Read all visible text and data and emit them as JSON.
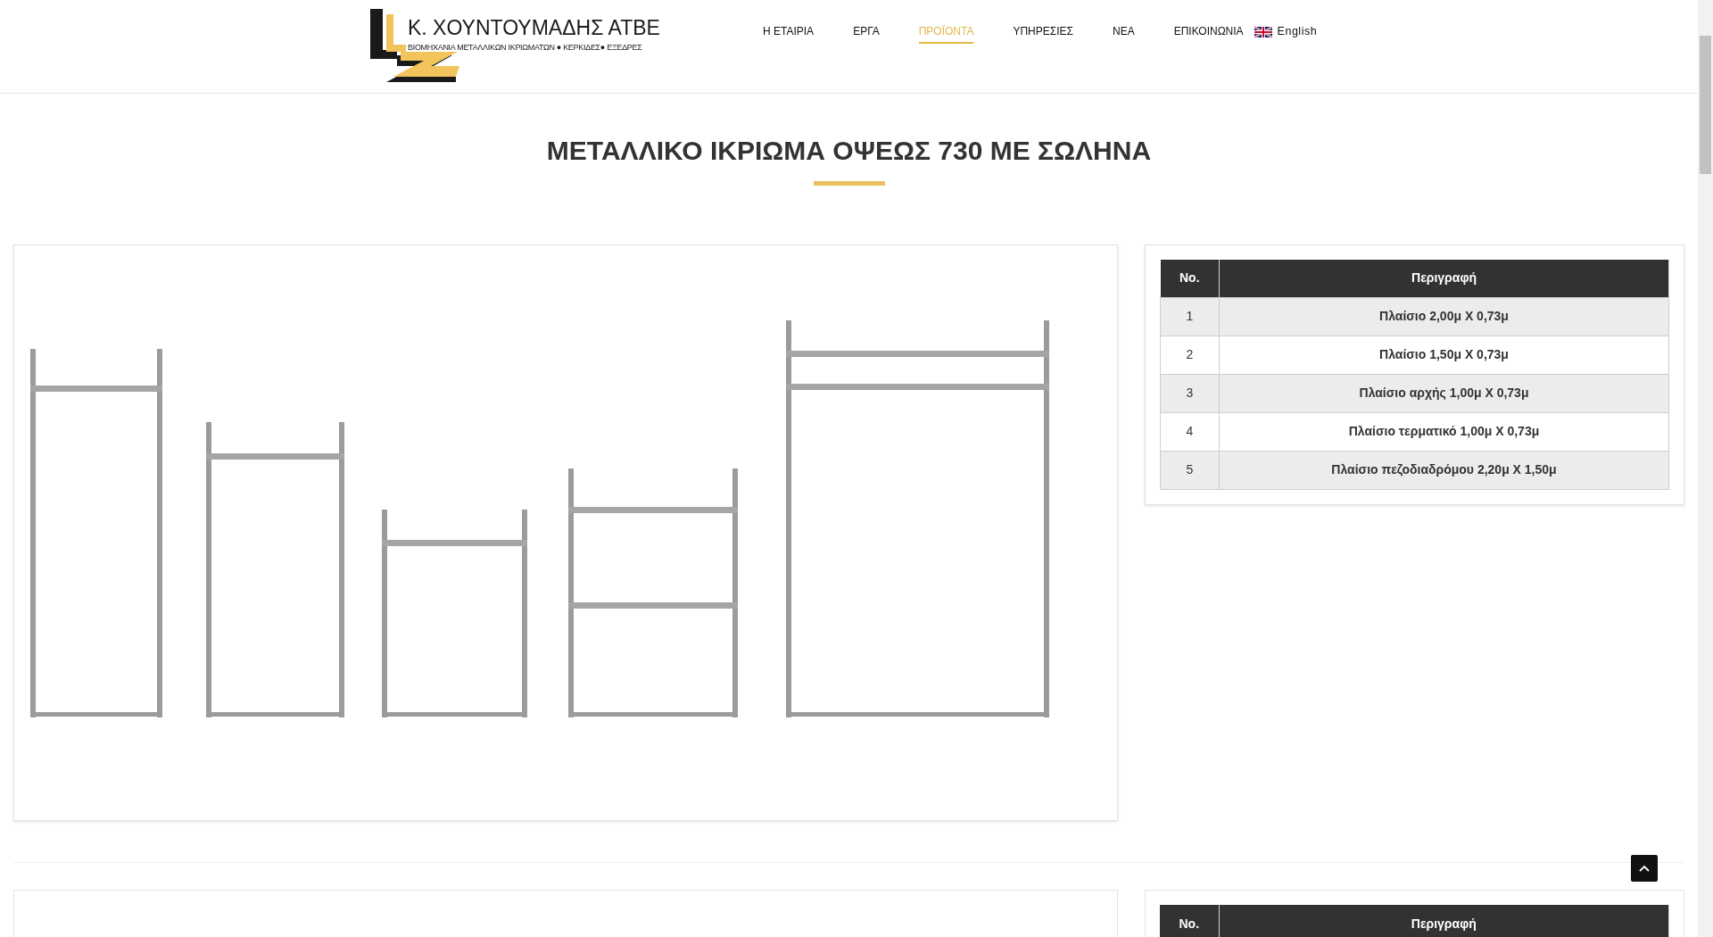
{
  "logo": {
    "name": "Κ. ΧΟΥΝΤΟΥΜΑΔΗΣ ΑΤΒΕ",
    "tagline": "ΒΙΟΜΗΧΑΝΙΑ ΜΕΤΑΛΛΙΚΩΝ ΙΚΡΙΩΜΑΤΩΝ ● ΚΕΡΚΙΔΕΣ● ΕΞΕΔΡΕΣ"
  },
  "nav": [
    {
      "label": "Η ΕΤΑΙΡΙΑ",
      "selected": false
    },
    {
      "label": "ΕΡΓΑ",
      "selected": false
    },
    {
      "label": "ΠΡΟΪΟΝΤΑ",
      "selected": true
    },
    {
      "label": "ΥΠΗΡΕΣΙΕΣ",
      "selected": false
    },
    {
      "label": "ΝΕΑ",
      "selected": false
    },
    {
      "label": "ΕΠΙΚΟΙΝΩΝΙΑ",
      "selected": false
    }
  ],
  "language": "English",
  "title": "ΜΕΤΑΛΛΙΚΟ ΙΚΡΙΩΜΑ ΟΨΕΩΣ 730 ΜΕ ΣΩΛΗΝΑ",
  "sections": [
    {
      "table": {
        "columns": [
          "No.",
          "Περιγραφή"
        ],
        "rows": [
          [
            "1",
            "Πλαίσιο 2,00μ Χ 0,73μ"
          ],
          [
            "2",
            "Πλαίσιο 1,50μ Χ 0,73μ"
          ],
          [
            "3",
            "Πλαίσιο αρχής 1,00μ Χ 0,73μ"
          ],
          [
            "4",
            "Πλαίσιο τερματικό 1,00μ Χ 0,73μ"
          ],
          [
            "5",
            "Πλαίσιο πεζοδιαδρόμου 2,20μ Χ 1,50μ"
          ]
        ]
      }
    },
    {
      "table": {
        "columns": [
          "No.",
          "Περιγραφή"
        ]
      }
    }
  ]
}
